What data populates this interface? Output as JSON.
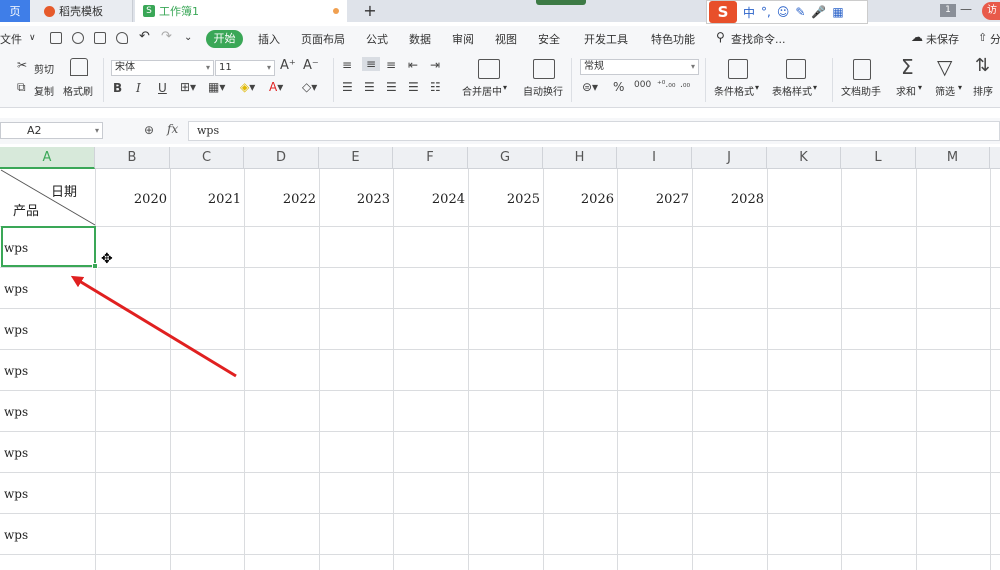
{
  "titlebar": {
    "home_tab": "页",
    "template_tab": "稻壳模板",
    "work_tab": "工作簿1",
    "work_tab_icon": "S",
    "new_tab": "+",
    "ime_logo": "S",
    "ime_items": [
      "中",
      "°,",
      "☺",
      "✎",
      "🎤",
      "▦"
    ],
    "window_badge": "1",
    "window_min": "—",
    "user_badge": "访"
  },
  "menu": {
    "file": "文件",
    "items": [
      "开始",
      "插入",
      "页面布局",
      "公式",
      "数据",
      "审阅",
      "视图",
      "安全",
      "开发工具",
      "特色功能"
    ],
    "search": "查找命令...",
    "unsaved": "未保存",
    "share": "分"
  },
  "ribbon": {
    "cut": "剪切",
    "copy": "复制",
    "format_painter": "格式刷",
    "font_name": "宋体",
    "font_size": "11",
    "merge_center": "合并居中",
    "wrap_text": "自动换行",
    "number_format": "常规",
    "conditional_format": "条件格式",
    "table_style": "表格样式",
    "doc_assistant": "文档助手",
    "sum": "求和",
    "filter": "筛选",
    "sort": "排序"
  },
  "formula_bar": {
    "cell_ref": "A2",
    "fx": "fx",
    "value": "wps"
  },
  "grid": {
    "columns": [
      "A",
      "B",
      "C",
      "D",
      "E",
      "F",
      "G",
      "H",
      "I",
      "J",
      "K",
      "L",
      "M"
    ],
    "header_diag_top": "日期",
    "header_diag_bottom": "产品",
    "years": [
      "2020",
      "2021",
      "2022",
      "2023",
      "2024",
      "2025",
      "2026",
      "2027",
      "2028"
    ],
    "rows": [
      "wps",
      "wps",
      "wps",
      "wps",
      "wps",
      "wps",
      "wps",
      "wps"
    ]
  },
  "colors": {
    "accent_green": "#3aa757",
    "arrow_red": "#e02020",
    "tab_blue": "#3f7ee8"
  }
}
